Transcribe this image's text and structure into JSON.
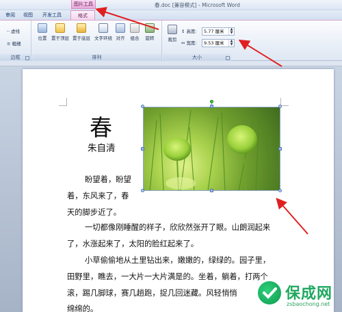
{
  "window": {
    "title": "春.doc [兼容模式] - Microsoft Word",
    "contextual_tab_group": "图片工具"
  },
  "tabs": [
    {
      "label": "审阅",
      "active": false
    },
    {
      "label": "视图",
      "active": false
    },
    {
      "label": "开发工具",
      "active": false
    },
    {
      "label": "格式",
      "active": true
    }
  ],
  "ribbon": {
    "border_group": {
      "items": [
        "虚线",
        "粗细"
      ],
      "label": "边框"
    },
    "arrange_group": {
      "buttons": [
        "位置",
        "置于顶层",
        "置于底层",
        "文字环绕",
        "对齐",
        "组合",
        "旋转"
      ],
      "label": "排列"
    },
    "size_group": {
      "crop_label": "裁剪",
      "height_label": "高度:",
      "height_value": "5.77 厘米",
      "width_label": "宽度:",
      "width_value": "9.53 厘米",
      "label": "大小"
    }
  },
  "document": {
    "title": "春",
    "author": "朱自清",
    "lines": [
      "盼望着，盼望",
      "着，东风来了，春",
      "天的脚步近了。",
      "一切都像刚睡醒的样子，欣欣然张开了眼。山朗润起来",
      "了，水涨起来了，太阳的脸红起来了。",
      "小草偷偷地从土里钻出来，嫩嫩的，绿绿的。园子里，",
      "田野里，瞧去，一大片一大片满是的。坐着，躺着，打两个",
      "滚，踢几脚球，赛几趟跑，捉几回迷藏。风轻悄悄",
      "绵绵的。"
    ]
  },
  "watermark": {
    "brand": "保成网",
    "url": "zsbaochong.net"
  },
  "colors": {
    "annotation_arrow": "#e02020",
    "picture_tools_tab": "#f4d3ec",
    "watermark_green": "#1fa85f"
  }
}
